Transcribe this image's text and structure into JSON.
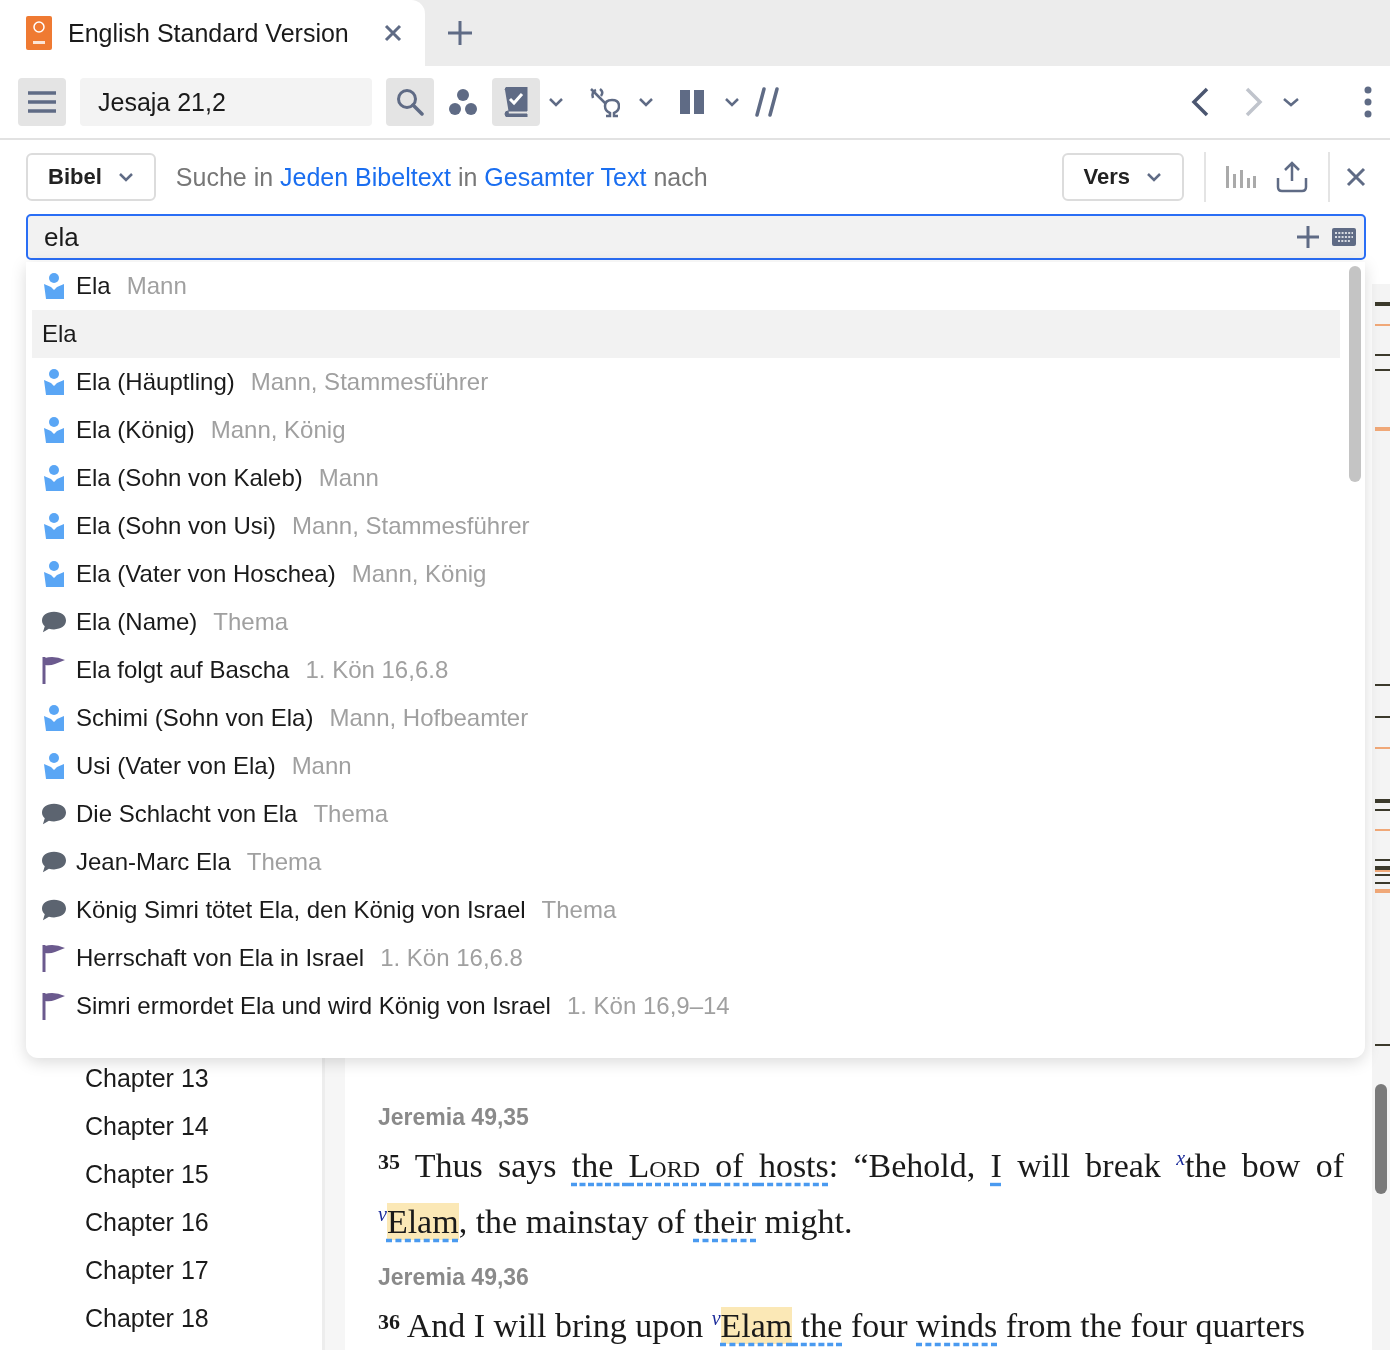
{
  "tab": {
    "title": "English Standard Version",
    "selected": true
  },
  "toolbar": {
    "reference": "Jesaja 21,2",
    "toggles": [
      {
        "kind": "book",
        "active": true
      },
      {
        "kind": "interlinear",
        "active": false
      },
      {
        "kind": "columns",
        "active": false
      }
    ],
    "back_disabled": false,
    "forward_disabled": true
  },
  "search": {
    "scope_button": "Bibel",
    "prefix": "Suche in",
    "scope_link": "Jeden Bibeltext",
    "middle": "in",
    "range_link": "Gesamter Text",
    "suffix": "nach",
    "unit_button": "Vers",
    "query": "ela"
  },
  "suggestions": [
    {
      "kind": "person",
      "label": "Ela",
      "detail": "Mann",
      "selected": false
    },
    {
      "kind": "plain",
      "label": "Ela",
      "selected": true
    },
    {
      "kind": "person",
      "label": "Ela (Häuptling)",
      "detail": "Mann, Stammesführer",
      "selected": false
    },
    {
      "kind": "person",
      "label": "Ela (König)",
      "detail": "Mann, König",
      "selected": false
    },
    {
      "kind": "person",
      "label": "Ela (Sohn von Kaleb)",
      "detail": "Mann",
      "selected": false
    },
    {
      "kind": "person",
      "label": "Ela (Sohn von Usi)",
      "detail": "Mann, Stammesführer",
      "selected": false
    },
    {
      "kind": "person",
      "label": "Ela (Vater von Hoschea)",
      "detail": "Mann, König",
      "selected": false
    },
    {
      "kind": "topic",
      "label": "Ela (Name)",
      "detail": "Thema",
      "selected": false
    },
    {
      "kind": "event",
      "label": "Ela folgt auf Bascha",
      "detail": "1. Kön 16,6.8",
      "selected": false
    },
    {
      "kind": "person",
      "label": "Schimi (Sohn von Ela)",
      "detail": "Mann, Hofbeamter",
      "selected": false
    },
    {
      "kind": "person",
      "label": "Usi (Vater von Ela)",
      "detail": "Mann",
      "selected": false
    },
    {
      "kind": "topic",
      "label": "Die Schlacht von Ela",
      "detail": "Thema",
      "selected": false
    },
    {
      "kind": "topic",
      "label": "Jean-Marc Ela",
      "detail": "Thema",
      "selected": false
    },
    {
      "kind": "topic",
      "label": "König Simri tötet Ela, den König von Israel",
      "detail": "Thema",
      "selected": false
    },
    {
      "kind": "event",
      "label": "Herrschaft von Ela in Israel",
      "detail": "1. Kön 16,6.8",
      "selected": false
    },
    {
      "kind": "event",
      "label": "Simri ermordet Ela und wird König von Israel",
      "detail": "1. Kön 16,9–14",
      "selected": false
    }
  ],
  "chapters": [
    {
      "label": "Chapter 13"
    },
    {
      "label": "Chapter 14"
    },
    {
      "label": "Chapter 15"
    },
    {
      "label": "Chapter 16"
    },
    {
      "label": "Chapter 17"
    },
    {
      "label": "Chapter 18"
    }
  ],
  "verses": [
    {
      "heading": "Jeremia 49,35",
      "number": "35",
      "segments": [
        {
          "kind": "plain",
          "text": "Thus says "
        },
        {
          "kind": "linked",
          "text": "the "
        },
        {
          "kind": "linked",
          "text": "Lord ",
          "smallcaps": true
        },
        {
          "kind": "linked",
          "text": "of "
        },
        {
          "kind": "linked",
          "text": "hosts"
        },
        {
          "kind": "plain",
          "text": ": “Behold, "
        },
        {
          "kind": "linked",
          "text": "I"
        },
        {
          "kind": "plain",
          "text": " will break "
        },
        {
          "kind": "note",
          "text": "x"
        },
        {
          "kind": "plain",
          "text": "the bow of "
        },
        {
          "kind": "note",
          "text": "v"
        },
        {
          "kind": "hit",
          "text": "Elam"
        },
        {
          "kind": "plain",
          "text": ", the mainstay of "
        },
        {
          "kind": "linked",
          "text": "their"
        },
        {
          "kind": "plain",
          "text": " might."
        }
      ]
    },
    {
      "heading": "Jeremia 49,36",
      "number": "36",
      "segments": [
        {
          "kind": "plain",
          "text": "And I will bring upon "
        },
        {
          "kind": "note",
          "text": "v"
        },
        {
          "kind": "hit",
          "text": "Elam"
        },
        {
          "kind": "linked",
          "text": " the"
        },
        {
          "kind": "plain",
          "text": " four "
        },
        {
          "kind": "linked",
          "text": "winds"
        },
        {
          "kind": "plain",
          "text": " from the four quarters"
        }
      ]
    }
  ]
}
